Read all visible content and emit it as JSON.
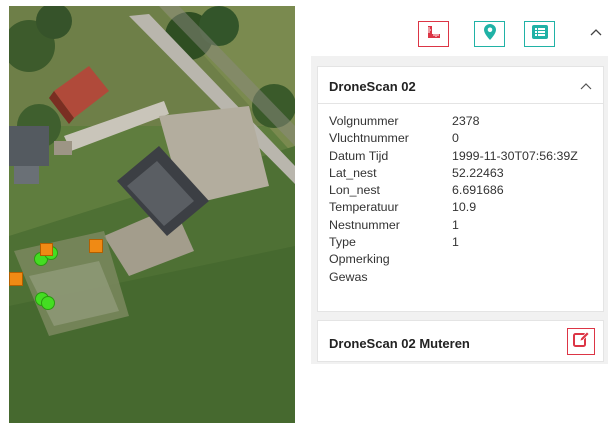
{
  "map": {
    "markers": [
      {
        "kind": "green-dot"
      },
      {
        "kind": "green-dot"
      },
      {
        "kind": "green-dot"
      },
      {
        "kind": "green-dot"
      },
      {
        "kind": "orange-square"
      },
      {
        "kind": "orange-square"
      },
      {
        "kind": "orange-square"
      }
    ]
  },
  "toolbar": {
    "buttons": [
      {
        "icon": "ruler-icon",
        "color": "#dc3545"
      },
      {
        "icon": "map-marker-icon",
        "color": "#20b2a6"
      },
      {
        "icon": "list-icon",
        "color": "#20b2a6"
      }
    ],
    "collapse_icon": "chevron-up-icon"
  },
  "details_card": {
    "title": "DroneScan 02",
    "rows": [
      {
        "label": "Volgnummer",
        "value": "2378"
      },
      {
        "label": "Vluchtnummer",
        "value": "0"
      },
      {
        "label": "Datum Tijd",
        "value": "1999-11-30T07:56:39Z"
      },
      {
        "label": "Lat_nest",
        "value": "52.22463"
      },
      {
        "label": "Lon_nest",
        "value": "6.691686"
      },
      {
        "label": "Temperatuur",
        "value": "10.9"
      },
      {
        "label": "Nestnummer",
        "value": "1"
      },
      {
        "label": "Type",
        "value": "1"
      },
      {
        "label": "Opmerking",
        "value": ""
      },
      {
        "label": "Gewas",
        "value": ""
      }
    ]
  },
  "edit_card": {
    "title": "DroneScan 02 Muteren",
    "edit_icon": "edit-icon"
  },
  "colors": {
    "danger": "#dc3545",
    "teal": "#20b2a6",
    "marker_green": "#44dd22",
    "marker_orange": "#f08a14"
  }
}
